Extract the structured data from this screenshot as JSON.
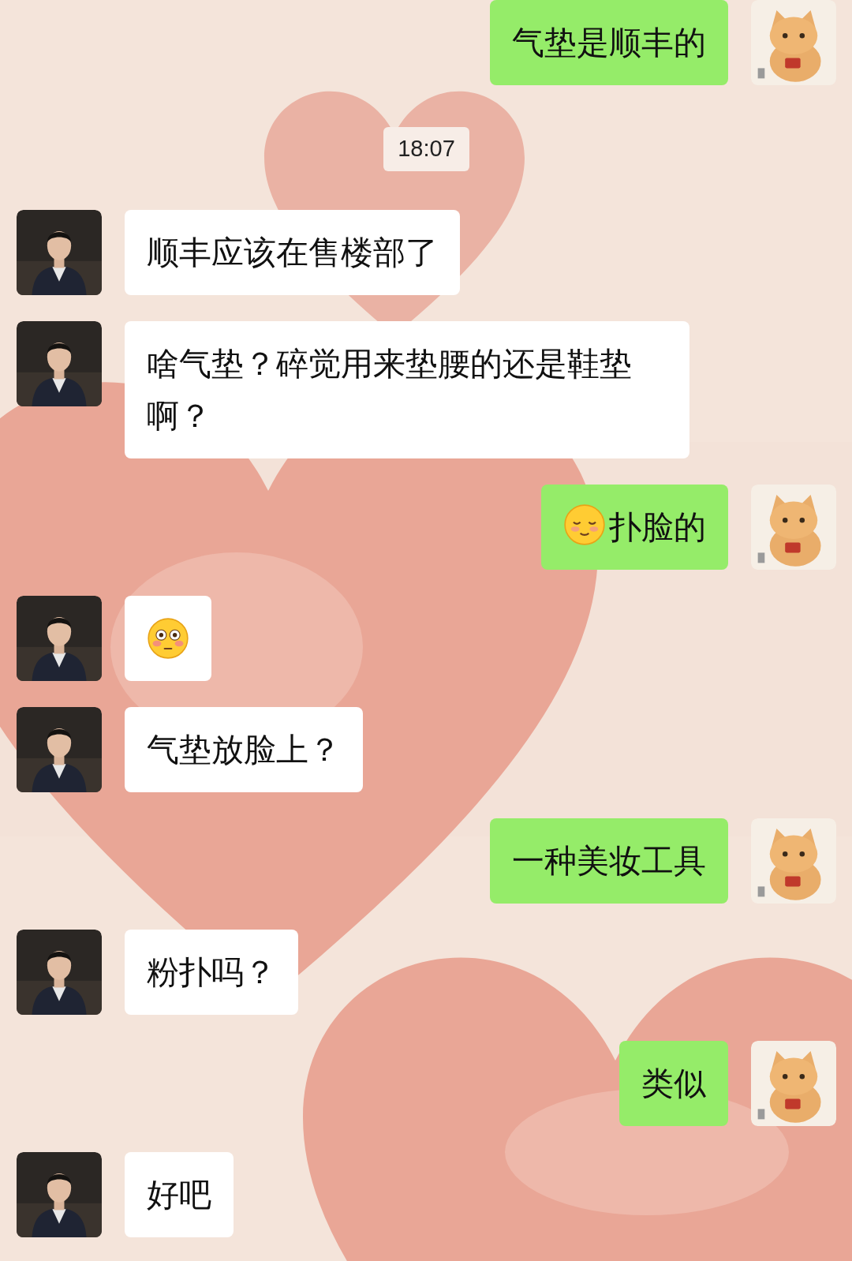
{
  "messages": [
    {
      "kind": "text",
      "outgoing": true,
      "text": "气垫是顺丰的"
    },
    {
      "kind": "time",
      "text": "18:07"
    },
    {
      "kind": "text",
      "outgoing": false,
      "text": "顺丰应该在售楼部了"
    },
    {
      "kind": "text",
      "outgoing": false,
      "text": "啥气垫？碎觉用来垫腰的还是鞋垫啊？"
    },
    {
      "kind": "emoji-lead",
      "outgoing": true,
      "text": "扑脸的"
    },
    {
      "kind": "emoji-only",
      "outgoing": false
    },
    {
      "kind": "text",
      "outgoing": false,
      "text": "气垫放脸上？"
    },
    {
      "kind": "text",
      "outgoing": true,
      "text": "一种美妆工具"
    },
    {
      "kind": "text",
      "outgoing": false,
      "text": "粉扑吗？"
    },
    {
      "kind": "text",
      "outgoing": true,
      "text": "类似"
    },
    {
      "kind": "text",
      "outgoing": false,
      "text": "好吧"
    }
  ]
}
